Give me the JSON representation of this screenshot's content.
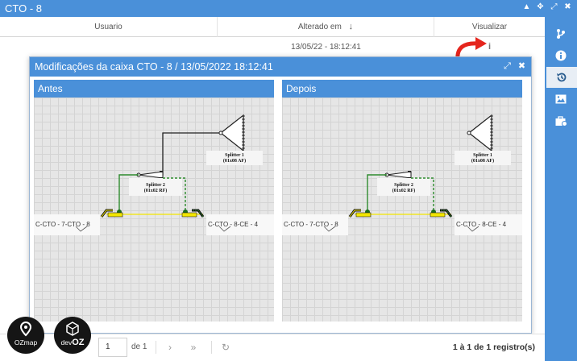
{
  "window": {
    "title": "CTO - 8"
  },
  "table": {
    "headers": {
      "usuario": "Usuario",
      "alterado": "Alterado em",
      "visualizar": "Visualizar"
    },
    "rows": [
      {
        "usuario": "",
        "alterado_em": "13/05/22 - 18:12:41"
      }
    ]
  },
  "modal": {
    "title": "Modificações da caixa CTO - 8 / 13/05/2022 18:12:41",
    "panels": {
      "antes": {
        "title": "Antes",
        "splitter1": {
          "name": "Splitter 1",
          "spec": "(01x08 AF)"
        },
        "splitter2": {
          "name": "Splitter 2",
          "spec": "(01x02 RF)"
        },
        "left_cable": "C-CTO - 7-CTO - 8",
        "right_cable": "C-CTO - 8-CE - 4"
      },
      "depois": {
        "title": "Depois",
        "splitter1": {
          "name": "Splitter 1",
          "spec": "(01x08 AF)"
        },
        "splitter2": {
          "name": "Splitter 2",
          "spec": "(01x02 RF)"
        },
        "left_cable": "C-CTO - 7-CTO - 8",
        "right_cable": "C-CTO - 8-CE - 4"
      }
    }
  },
  "pagination": {
    "page": "1",
    "of_label": "de 1",
    "count": "1 à 1 de 1 registro(s)"
  },
  "logos": {
    "ozmap": "OZmap",
    "devoz_prefix": "dev",
    "devoz_suffix": "OZ"
  },
  "colors": {
    "accent": "#4a90d9",
    "arrow": "#e5251d",
    "fiber_green": "#2e8b2e",
    "fiber_yellow": "#f2e600"
  }
}
